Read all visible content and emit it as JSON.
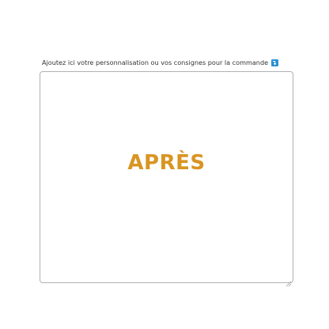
{
  "form": {
    "label": "Ajoutez ici votre personnalisation ou vos consignes pour la commande",
    "info_icon": "info-arrow-icon",
    "textarea_value": "",
    "overlay_text": "APRÈS"
  },
  "colors": {
    "accent": "#d99522",
    "icon_bg": "#2a8fd6",
    "border": "#b3b3b3"
  }
}
